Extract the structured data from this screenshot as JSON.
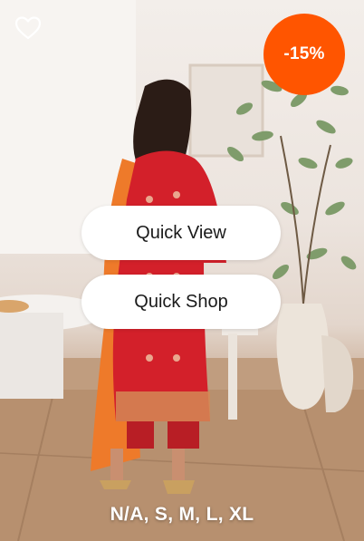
{
  "product": {
    "discount_badge": "-15%",
    "sizes": "N/A, S, M, L, XL"
  },
  "actions": {
    "quick_view_label": "Quick View",
    "quick_shop_label": "Quick Shop"
  },
  "icons": {
    "wishlist": "heart-outline-icon"
  },
  "colors": {
    "badge": "#ff5500",
    "dress": "#d3202a",
    "dupatta": "#ee7a2a"
  }
}
